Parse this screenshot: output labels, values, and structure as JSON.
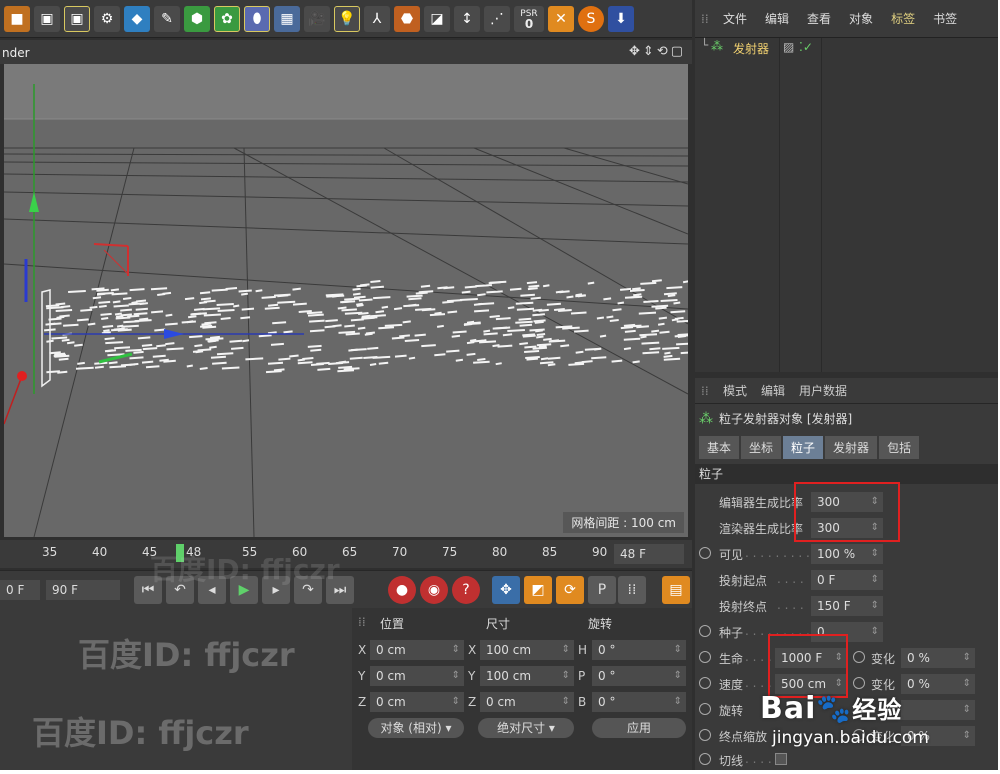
{
  "viewport": {
    "title": "nder",
    "grid_spacing": "网格间距 : 100 cm"
  },
  "timeline": {
    "ticks": [
      "35",
      "40",
      "45",
      "50",
      "55",
      "60",
      "65",
      "70",
      "75",
      "80",
      "85",
      "90"
    ],
    "current_frame": "48",
    "end_frame": "48 F",
    "start_field": "0 F",
    "max_field": "90 F"
  },
  "coordinates": {
    "headers": {
      "position": "位置",
      "size": "尺寸",
      "rotation": "旋转"
    },
    "rows": [
      {
        "axis": "X",
        "pos": "0 cm",
        "size_axis": "X",
        "size": "100 cm",
        "rot_axis": "H",
        "rot": "0 °"
      },
      {
        "axis": "Y",
        "pos": "0 cm",
        "size_axis": "Y",
        "size": "100 cm",
        "rot_axis": "P",
        "rot": "0 °"
      },
      {
        "axis": "Z",
        "pos": "0 cm",
        "size_axis": "Z",
        "size": "0 cm",
        "rot_axis": "B",
        "rot": "0 °"
      }
    ],
    "mode_dropdown": "对象 (相对)",
    "size_dropdown": "绝对尺寸",
    "apply_button": "应用"
  },
  "object_manager": {
    "menu": [
      "文件",
      "编辑",
      "查看",
      "对象",
      "标签",
      "书签"
    ],
    "active_menu": "标签",
    "object_name": "发射器"
  },
  "attribute_manager": {
    "menu": [
      "模式",
      "编辑",
      "用户数据"
    ],
    "title": "粒子发射器对象 [发射器]",
    "tabs": [
      "基本",
      "坐标",
      "粒子",
      "发射器",
      "包括"
    ],
    "active_tab": "粒子",
    "section": "粒子",
    "props": {
      "editor_rate_label": "编辑器生成比率",
      "editor_rate": "300",
      "render_rate_label": "渲染器生成比率",
      "render_rate": "300",
      "visible_label": "可见",
      "visible": "100 %",
      "start_label": "投射起点",
      "start": "0 F",
      "end_label": "投射终点",
      "end": "150 F",
      "seed_label": "种子",
      "seed": "0",
      "life_label": "生命",
      "life": "1000 F",
      "life_var_label": "变化",
      "life_var": "0 %",
      "speed_label": "速度",
      "speed": "500 cm",
      "speed_var_label": "变化",
      "speed_var": "0 %",
      "rotation_label": "旋转",
      "end_scale_label": "终点缩放",
      "end_scale_var_label": "变化",
      "end_scale_var": "0 %",
      "tangent_label": "切线"
    }
  },
  "watermark": {
    "text": "百度ID: ffjczr",
    "brand": "Bai",
    "brand_cn": "经验",
    "url": "jingyan.baidu.com"
  },
  "colors": {
    "panel": "#3a3a3a",
    "viewport": "#686868",
    "highlight": "#e02020",
    "active_tab": "#6c7f96"
  }
}
